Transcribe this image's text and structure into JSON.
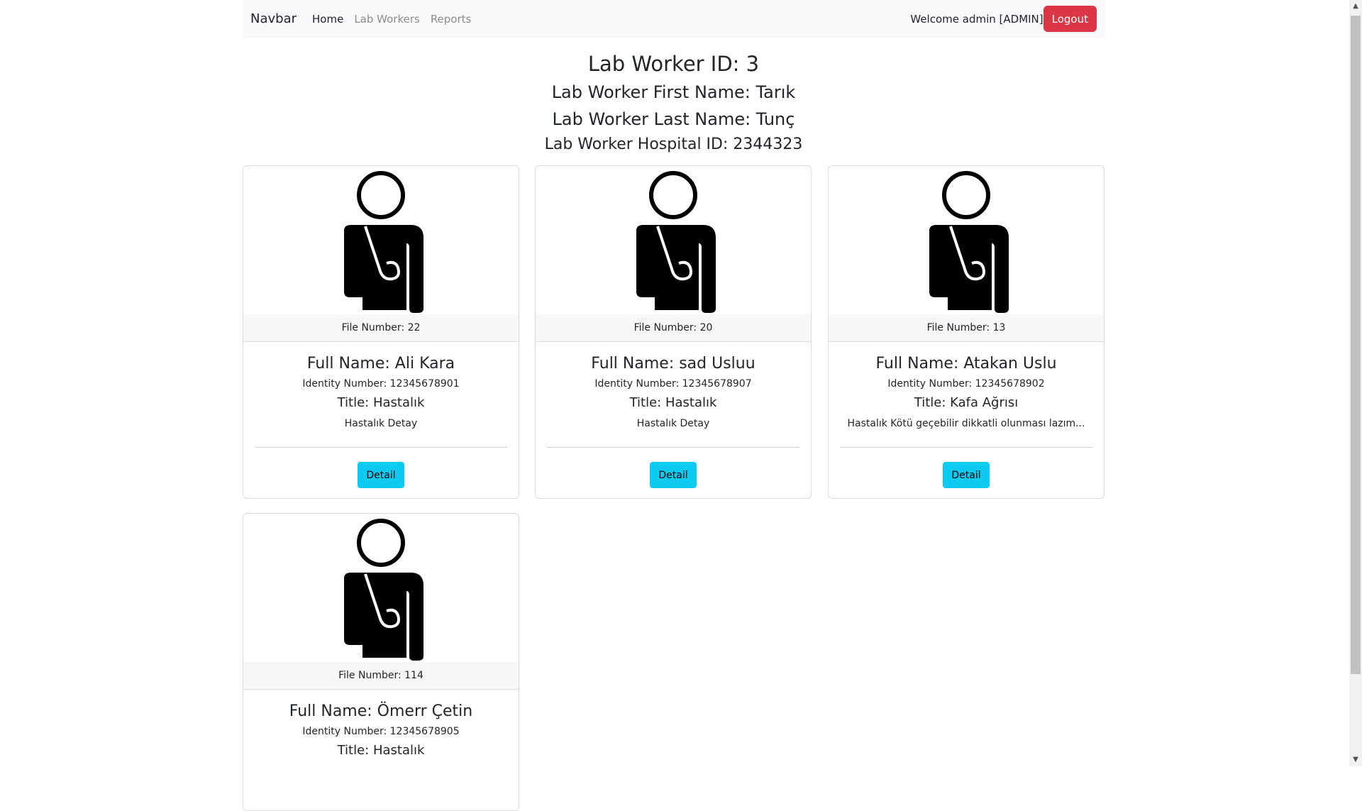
{
  "navbar": {
    "brand": "Navbar",
    "links": [
      "Home",
      "Lab Workers",
      "Reports"
    ],
    "welcome": "Welcome admin [ADMIN]",
    "logout_label": "Logout"
  },
  "worker": {
    "id_line": "Lab Worker ID: 3",
    "first_name_line": "Lab Worker First Name: Tarık",
    "last_name_line": "Lab Worker Last Name: Tunç",
    "hospital_line": "Lab Worker Hospital ID: 2344323"
  },
  "cards": [
    {
      "file_number": "File Number: 22",
      "full_name": "Full Name: Ali Kara",
      "identity": "Identity Number: 12345678901",
      "title": "Title: Hastalık",
      "description": "Hastalık Detay",
      "button": "Detail"
    },
    {
      "file_number": "File Number: 20",
      "full_name": "Full Name: sad Usluu",
      "identity": "Identity Number: 12345678907",
      "title": "Title: Hastalık",
      "description": "Hastalık Detay",
      "button": "Detail"
    },
    {
      "file_number": "File Number: 13",
      "full_name": "Full Name: Atakan Uslu",
      "identity": "Identity Number: 12345678902",
      "title": "Title: Kafa Ağrısı",
      "description": "Hastalık Kötü geçebilir dikkatli olunması lazım...",
      "button": "Detail"
    },
    {
      "file_number": "File Number: 114",
      "full_name": "Full Name: Ömerr Çetin",
      "identity": "Identity Number: 12345678905",
      "title": "Title: Hastalık"
    }
  ],
  "colors": {
    "danger": "#dc3545",
    "info": "#0dcaf0",
    "navbar_bg": "#f8f9fa"
  },
  "icons": {
    "patient": "injured-person-icon"
  }
}
